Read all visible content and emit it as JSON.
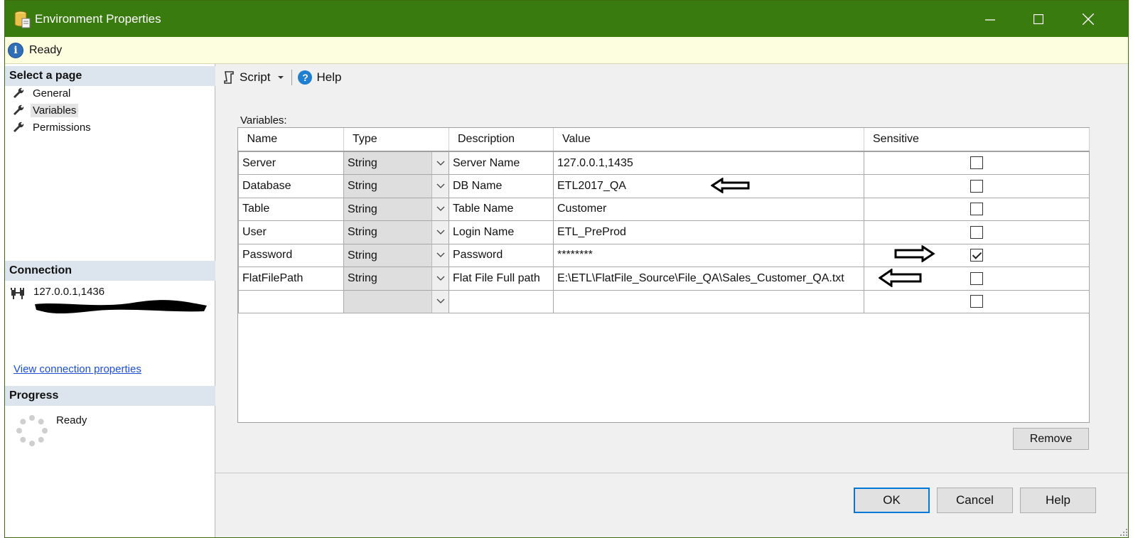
{
  "window": {
    "title": "Environment Properties"
  },
  "status": {
    "text": "Ready"
  },
  "sidebar": {
    "select_page_header": "Select a page",
    "items": [
      {
        "label": "General"
      },
      {
        "label": "Variables"
      },
      {
        "label": "Permissions"
      }
    ],
    "connection_header": "Connection",
    "connection_server": "127.0.0.1,1436",
    "view_connection_link": "View connection properties",
    "progress_header": "Progress",
    "progress_status": "Ready"
  },
  "toolbar": {
    "script_label": "Script",
    "help_label": "Help"
  },
  "variables": {
    "label": "Variables:",
    "columns": [
      "Name",
      "Type",
      "Description",
      "Value",
      "Sensitive"
    ],
    "rows": [
      {
        "name": "Server",
        "type": "String",
        "description": "Server Name",
        "value": "127.0.0.1,1435",
        "sensitive": false
      },
      {
        "name": "Database",
        "type": "String",
        "description": "DB Name",
        "value": "ETL2017_QA",
        "sensitive": false
      },
      {
        "name": "Table",
        "type": "String",
        "description": "Table Name",
        "value": "Customer",
        "sensitive": false
      },
      {
        "name": "User",
        "type": "String",
        "description": "Login Name",
        "value": "ETL_PreProd",
        "sensitive": false
      },
      {
        "name": "Password",
        "type": "String",
        "description": "Password",
        "value": "********",
        "sensitive": true
      },
      {
        "name": "FlatFilePath",
        "type": "String",
        "description": "Flat File Full path",
        "value": "E:\\ETL\\FlatFile_Source\\File_QA\\Sales_Customer_QA.txt",
        "sensitive": false
      },
      {
        "name": "",
        "type": "",
        "description": "",
        "value": "",
        "sensitive": false
      }
    ]
  },
  "buttons": {
    "remove": "Remove",
    "ok": "OK",
    "cancel": "Cancel",
    "help": "Help"
  },
  "colors": {
    "titlebar": "#3a7b10",
    "statusbar": "#fdfde0",
    "section_header": "#dce5ee",
    "link": "#1a4fd6"
  }
}
